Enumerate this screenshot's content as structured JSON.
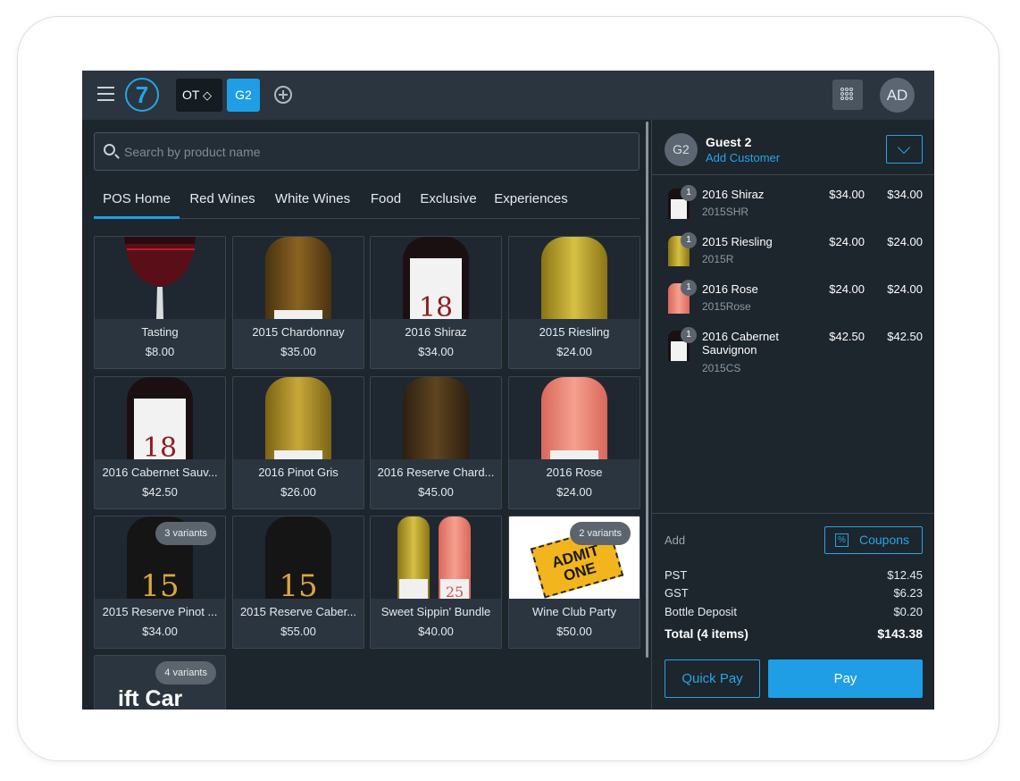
{
  "topbar": {
    "logo_text": "7",
    "tabs": [
      {
        "label": "OT",
        "icon": "diamond-icon"
      },
      {
        "label": "G2"
      }
    ],
    "avatar_initials": "AD"
  },
  "search": {
    "placeholder": "Search by product name"
  },
  "categories": [
    "POS Home",
    "Red Wines",
    "White Wines",
    "Food",
    "Exclusive",
    "Experiences"
  ],
  "active_category": "POS Home",
  "products": [
    {
      "name": "Tasting",
      "price": "$8.00"
    },
    {
      "name": "2015 Chardonnay",
      "price": "$35.00"
    },
    {
      "name": "2016 Shiraz",
      "price": "$34.00",
      "label_num": "18"
    },
    {
      "name": "2015 Riesling",
      "price": "$24.00"
    },
    {
      "name": "2016 Cabernet Sauv...",
      "price": "$42.50",
      "label_num": "18"
    },
    {
      "name": "2016 Pinot Gris",
      "price": "$26.00"
    },
    {
      "name": "2016 Reserve Chard...",
      "price": "$45.00"
    },
    {
      "name": "2016 Rose",
      "price": "$24.00"
    },
    {
      "name": "2015 Reserve Pinot ...",
      "price": "$34.00",
      "badge": "3 variants",
      "label_num": "15"
    },
    {
      "name": "2015 Reserve Caber...",
      "price": "$55.00",
      "label_num": "15"
    },
    {
      "name": "Sweet Sippin' Bundle",
      "price": "$40.00",
      "label_num": "25"
    },
    {
      "name": "Wine Club Party",
      "price": "$50.00",
      "badge": "2 variants",
      "ticket_text": "ADMIT ONE"
    },
    {
      "badge": "4 variants",
      "image_text": "ift Car"
    }
  ],
  "customer": {
    "initials": "G2",
    "name": "Guest 2",
    "add_label": "Add Customer"
  },
  "order_lines": [
    {
      "qty": "1",
      "name": "2016 Shiraz",
      "sku": "2015SHR",
      "unit": "$34.00",
      "total": "$34.00"
    },
    {
      "qty": "1",
      "name": "2015 Riesling",
      "sku": "2015R",
      "unit": "$24.00",
      "total": "$24.00"
    },
    {
      "qty": "1",
      "name": "2016 Rose",
      "sku": "2015Rose",
      "unit": "$24.00",
      "total": "$24.00"
    },
    {
      "qty": "1",
      "name": "2016 Cabernet Sauvignon",
      "sku": "2015CS",
      "unit": "$42.50",
      "total": "$42.50"
    }
  ],
  "summary": {
    "add_label": "Add",
    "coupons_label": "Coupons",
    "coupons_icon": "%",
    "rows": [
      {
        "label": "PST",
        "value": "$12.45"
      },
      {
        "label": "GST",
        "value": "$6.23"
      },
      {
        "label": "Bottle Deposit",
        "value": "$0.20"
      }
    ],
    "total_label": "Total (4 items)",
    "total_value": "$143.38"
  },
  "actions": {
    "quick_pay": "Quick Pay",
    "pay": "Pay"
  },
  "colors": {
    "accent": "#1f9ee6",
    "background": "#1d252d",
    "topbar": "#2a3540",
    "red_wine": "#8c1d22",
    "rose_wine": "#f08a78",
    "white_wine": "#c9a83a"
  }
}
